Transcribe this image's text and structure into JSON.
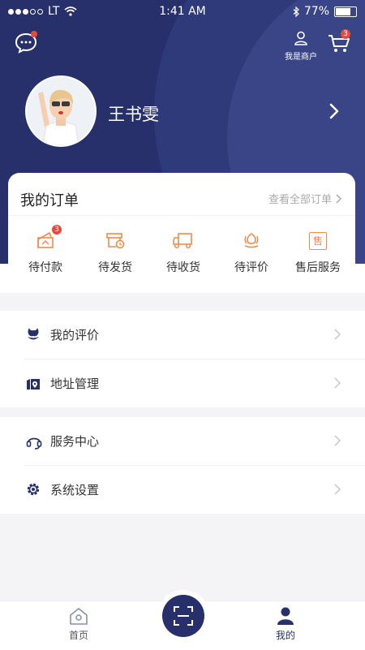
{
  "status_bar": {
    "carrier": "LT",
    "time": "1:41 AM",
    "battery_percent": "77%"
  },
  "header": {
    "message_icon": "chat-bubble-icon",
    "merchant_label": "我是商户",
    "cart_badge": "3",
    "username": "王书雯"
  },
  "orders": {
    "title": "我的订单",
    "view_all": "查看全部订单",
    "items": [
      {
        "label": "待付款",
        "icon": "wallet-icon",
        "badge": "3"
      },
      {
        "label": "待发货",
        "icon": "package-icon"
      },
      {
        "label": "待收货",
        "icon": "truck-icon"
      },
      {
        "label": "待评价",
        "icon": "rate-icon"
      },
      {
        "label": "售后服务",
        "icon": "after-sales-icon",
        "icon_text": "售"
      }
    ]
  },
  "menu1": [
    {
      "label": "我的评价",
      "icon": "review-icon"
    },
    {
      "label": "地址管理",
      "icon": "address-icon"
    }
  ],
  "menu2": [
    {
      "label": "服务中心",
      "icon": "headset-icon"
    },
    {
      "label": "系统设置",
      "icon": "gear-icon"
    }
  ],
  "tabbar": {
    "home": "首页",
    "mine": "我的"
  },
  "colors": {
    "primary": "#27306a",
    "accent": "#f08a4b",
    "badge": "#e64a3c"
  }
}
